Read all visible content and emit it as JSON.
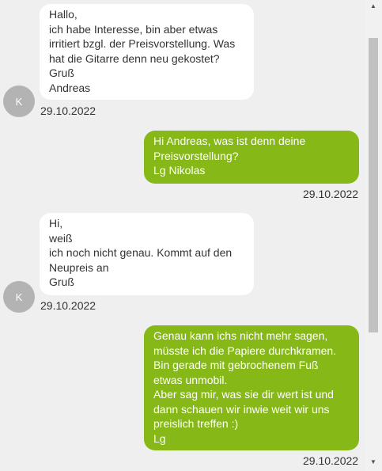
{
  "messages": [
    {
      "side": "in",
      "avatar": "K",
      "text": "Hallo,\nich habe Interesse, bin aber etwas irritiert bzgl. der Preisvorstellung. Was hat die Gitarre denn neu gekostet?\nGruß\nAndreas",
      "date": "29.10.2022"
    },
    {
      "side": "out",
      "text": "Hi Andreas, was ist denn deine Preisvorstellung?\nLg Nikolas",
      "date": "29.10.2022"
    },
    {
      "side": "in",
      "avatar": "K",
      "text": "Hi,\nweiß\nich noch nicht genau. Kommt auf den Neupreis an\nGruß",
      "date": "29.10.2022"
    },
    {
      "side": "out",
      "text": "Genau kann ichs nicht mehr sagen, müsste ich die Papiere durchkramen.\nBin gerade mit gebrochenem Fuß etwas unmobil.\nAber sag mir, was sie dir wert ist und dann schauen wir inwie weit wir uns preislich treffen :)\nLg",
      "date": "29.10.2022"
    }
  ],
  "scrollbar": {
    "up_icon": "triangle-up",
    "down_icon": "triangle-down",
    "position_fraction": 0.08
  }
}
